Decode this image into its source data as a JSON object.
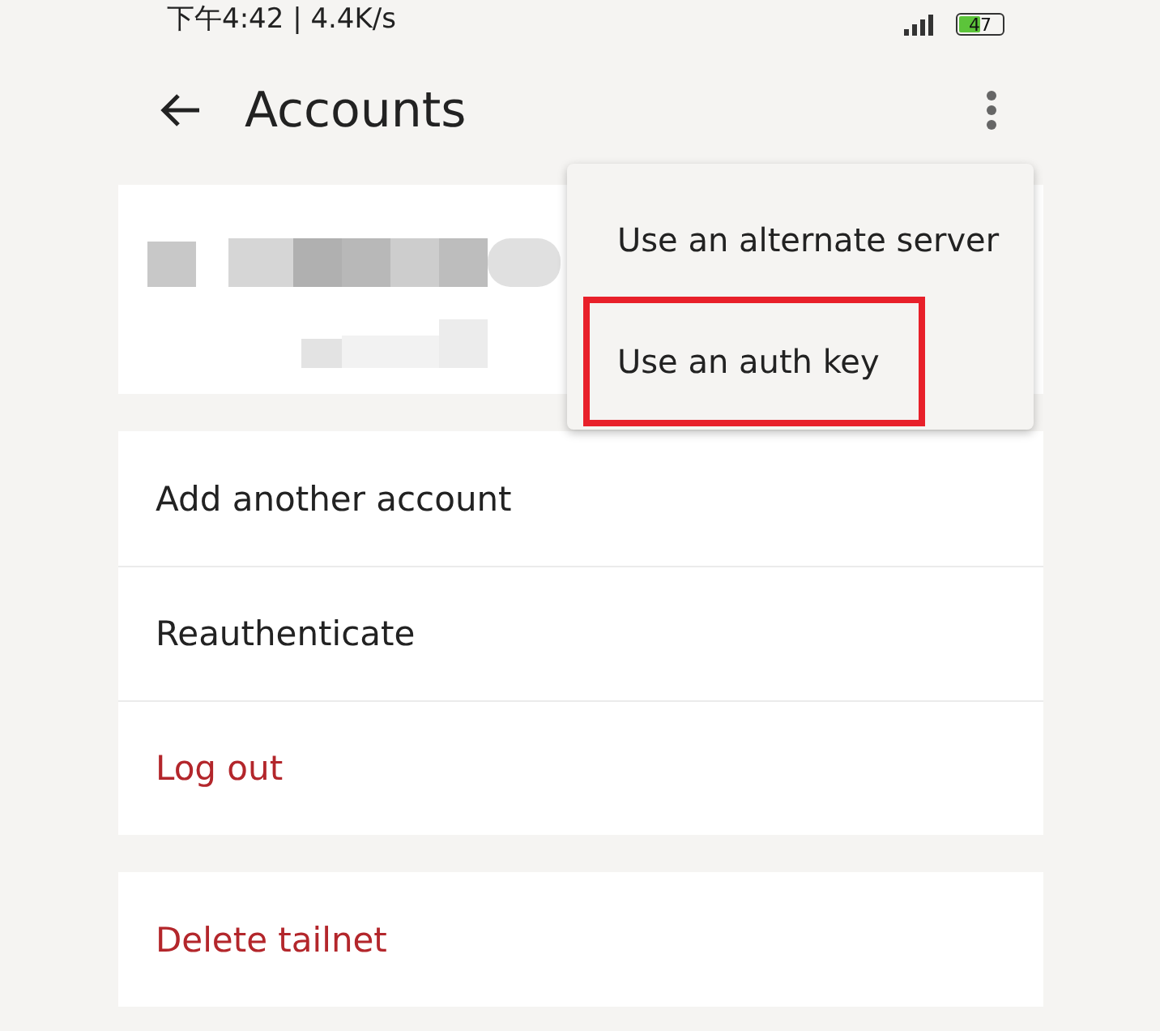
{
  "status_bar": {
    "time_speed": "下午4:42 | 4.4K/s",
    "battery": "47"
  },
  "header": {
    "title": "Accounts"
  },
  "menu": {
    "items": [
      {
        "label": "Use an alternate server",
        "highlighted": false
      },
      {
        "label": "Use an auth key",
        "highlighted": true
      }
    ]
  },
  "account_actions": [
    {
      "label": "Add another account",
      "kind": "normal"
    },
    {
      "label": "Reauthenticate",
      "kind": "normal"
    },
    {
      "label": "Log out",
      "kind": "danger"
    }
  ],
  "tailnet_actions": [
    {
      "label": "Delete tailnet",
      "kind": "danger"
    }
  ]
}
